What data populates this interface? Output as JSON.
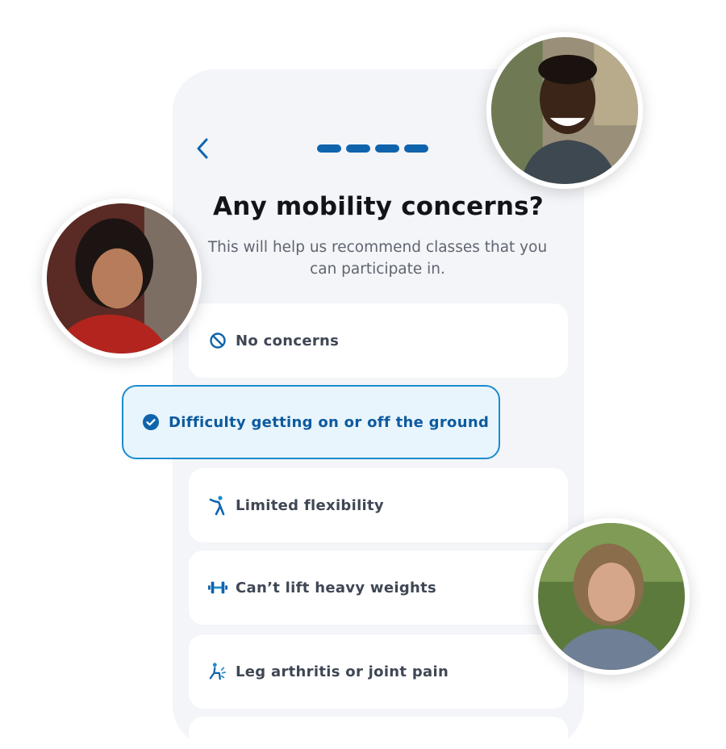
{
  "header": {
    "back_icon": "chevron-left-icon",
    "progress_steps": 4,
    "progress_current": 4
  },
  "title": "Any mobility concerns?",
  "subtitle": "This will help us recommend classes that you can participate in.",
  "options": [
    {
      "label": "No concerns",
      "icon": "ban-icon",
      "selected": false
    },
    {
      "label": "Difficulty getting on or off the ground",
      "icon": "check-circle-icon",
      "selected": true
    },
    {
      "label": "Limited flexibility",
      "icon": "stretch-icon",
      "selected": false
    },
    {
      "label": "Can’t lift heavy weights",
      "icon": "dumbbell-icon",
      "selected": false
    },
    {
      "label": "Leg arthritis or joint pain",
      "icon": "joint-pain-icon",
      "selected": false
    }
  ],
  "colors": {
    "accent": "#0f64ad",
    "selected_border": "#1b8ccd",
    "selected_bg": "#e8f5fd",
    "phone_bg": "#f3f5f8"
  }
}
